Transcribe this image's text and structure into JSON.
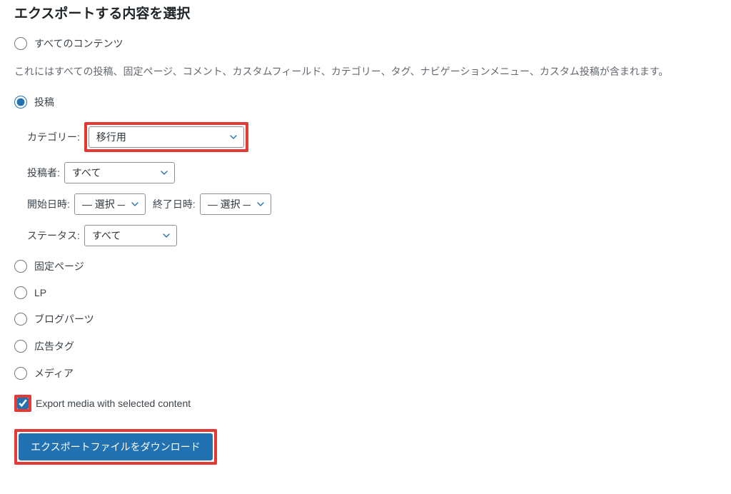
{
  "heading": "エクスポートする内容を選択",
  "options": {
    "all": {
      "label": "すべてのコンテンツ",
      "description": "これにはすべての投稿、固定ページ、コメント、カスタムフィールド、カテゴリー、タグ、ナビゲーションメニュー、カスタム投稿が含まれます。"
    },
    "posts": {
      "label": "投稿",
      "category_label": "カテゴリー:",
      "category_value": "移行用",
      "author_label": "投稿者:",
      "author_value": "すべて",
      "start_date_label": "開始日時:",
      "start_date_value": "— 選択 —",
      "end_date_label": "終了日時:",
      "end_date_value": "— 選択 —",
      "status_label": "ステータス:",
      "status_value": "すべて"
    },
    "pages": {
      "label": "固定ページ"
    },
    "lp": {
      "label": "LP"
    },
    "blog_parts": {
      "label": "ブログパーツ"
    },
    "ad_tag": {
      "label": "広告タグ"
    },
    "media": {
      "label": "メディア"
    }
  },
  "export_media_checkbox": {
    "label": "Export media with selected content",
    "checked": true
  },
  "submit_button": "エクスポートファイルをダウンロード"
}
